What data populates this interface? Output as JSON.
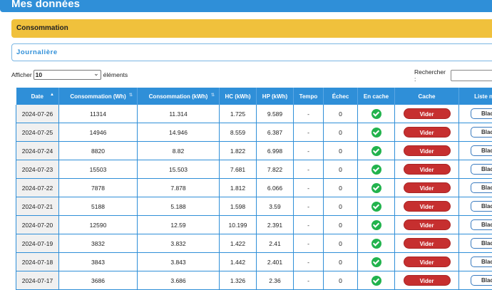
{
  "header": {
    "title": "Mes données"
  },
  "section": {
    "title": "Consommation"
  },
  "tab": {
    "label": "Journalière"
  },
  "controls": {
    "show_label": "Afficher",
    "page_size": "10",
    "entries_label": "éléments",
    "search_label": "Rechercher :"
  },
  "table": {
    "columns": [
      "Date",
      "Consommation (Wh)",
      "Consommation (kWh)",
      "HC (kWh)",
      "HP (kWh)",
      "Tempo",
      "Échec",
      "En cache",
      "Cache",
      "Liste n"
    ],
    "rows": [
      {
        "date": "2024-07-26",
        "wh": "11314",
        "kwh": "11.314",
        "hc": "1.725",
        "hp": "9.589",
        "tempo": "-",
        "echec": "0",
        "cache_btn": "Vider",
        "list_btn": "Black"
      },
      {
        "date": "2024-07-25",
        "wh": "14946",
        "kwh": "14.946",
        "hc": "8.559",
        "hp": "6.387",
        "tempo": "-",
        "echec": "0",
        "cache_btn": "Vider",
        "list_btn": "Black"
      },
      {
        "date": "2024-07-24",
        "wh": "8820",
        "kwh": "8.82",
        "hc": "1.822",
        "hp": "6.998",
        "tempo": "-",
        "echec": "0",
        "cache_btn": "Vider",
        "list_btn": "Black"
      },
      {
        "date": "2024-07-23",
        "wh": "15503",
        "kwh": "15.503",
        "hc": "7.681",
        "hp": "7.822",
        "tempo": "-",
        "echec": "0",
        "cache_btn": "Vider",
        "list_btn": "Black"
      },
      {
        "date": "2024-07-22",
        "wh": "7878",
        "kwh": "7.878",
        "hc": "1.812",
        "hp": "6.066",
        "tempo": "-",
        "echec": "0",
        "cache_btn": "Vider",
        "list_btn": "Black"
      },
      {
        "date": "2024-07-21",
        "wh": "5188",
        "kwh": "5.188",
        "hc": "1.598",
        "hp": "3.59",
        "tempo": "-",
        "echec": "0",
        "cache_btn": "Vider",
        "list_btn": "Black"
      },
      {
        "date": "2024-07-20",
        "wh": "12590",
        "kwh": "12.59",
        "hc": "10.199",
        "hp": "2.391",
        "tempo": "-",
        "echec": "0",
        "cache_btn": "Vider",
        "list_btn": "Black"
      },
      {
        "date": "2024-07-19",
        "wh": "3832",
        "kwh": "3.832",
        "hc": "1.422",
        "hp": "2.41",
        "tempo": "-",
        "echec": "0",
        "cache_btn": "Vider",
        "list_btn": "Black"
      },
      {
        "date": "2024-07-18",
        "wh": "3843",
        "kwh": "3.843",
        "hc": "1.442",
        "hp": "2.401",
        "tempo": "-",
        "echec": "0",
        "cache_btn": "Vider",
        "list_btn": "Black"
      },
      {
        "date": "2024-07-17",
        "wh": "3686",
        "kwh": "3.686",
        "hc": "1.326",
        "hp": "2.36",
        "tempo": "-",
        "echec": "0",
        "cache_btn": "Vider",
        "list_btn": "Black"
      }
    ]
  },
  "colors": {
    "primary": "#2f8fd8",
    "section": "#f0c13c",
    "danger": "#c62f2f",
    "success": "#22b34d"
  },
  "icons": {
    "cached": "check-circle-icon",
    "sort": "sort-arrows-icon"
  }
}
